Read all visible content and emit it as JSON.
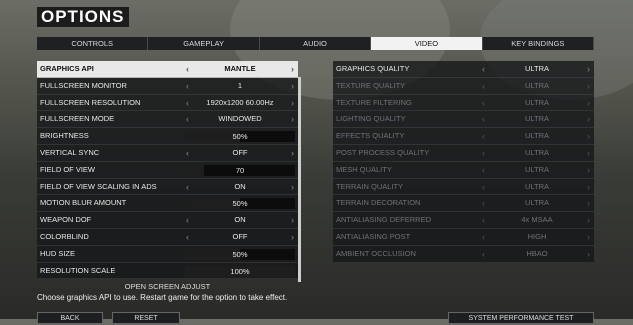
{
  "title": "OPTIONS",
  "tabs": [
    {
      "label": "CONTROLS",
      "active": false
    },
    {
      "label": "GAMEPLAY",
      "active": false
    },
    {
      "label": "AUDIO",
      "active": false
    },
    {
      "label": "VIDEO",
      "active": true
    },
    {
      "label": "KEY BINDINGS",
      "active": false
    }
  ],
  "left_settings": [
    {
      "label": "GRAPHICS API",
      "value": "MANTLE",
      "kind": "select",
      "selected": true
    },
    {
      "label": "FULLSCREEN MONITOR",
      "value": "1",
      "kind": "select"
    },
    {
      "label": "FULLSCREEN RESOLUTION",
      "value": "1920x1200 60.00Hz",
      "kind": "select"
    },
    {
      "label": "FULLSCREEN MODE",
      "value": "WINDOWED",
      "kind": "select"
    },
    {
      "label": "BRIGHTNESS",
      "value": "50%",
      "kind": "slider",
      "level": 0.5
    },
    {
      "label": "VERTICAL SYNC",
      "value": "OFF",
      "kind": "select"
    },
    {
      "label": "FIELD OF VIEW",
      "value": "70",
      "kind": "slider",
      "level": 0.17
    },
    {
      "label": "FIELD OF VIEW SCALING IN ADS",
      "value": "ON",
      "kind": "select"
    },
    {
      "label": "MOTION BLUR AMOUNT",
      "value": "50%",
      "kind": "slider",
      "level": 0.5
    },
    {
      "label": "WEAPON DOF",
      "value": "ON",
      "kind": "select"
    },
    {
      "label": "COLORBLIND",
      "value": "OFF",
      "kind": "select"
    },
    {
      "label": "HUD SIZE",
      "value": "50%",
      "kind": "slider",
      "level": 0.5
    },
    {
      "label": "RESOLUTION SCALE",
      "value": "100%",
      "kind": "slider",
      "level": 1.0
    }
  ],
  "right_settings": [
    {
      "label": "GRAPHICS QUALITY",
      "value": "ULTRA",
      "enabled": true
    },
    {
      "label": "TEXTURE QUALITY",
      "value": "ULTRA",
      "enabled": false
    },
    {
      "label": "TEXTURE FILTERING",
      "value": "ULTRA",
      "enabled": false
    },
    {
      "label": "LIGHTING QUALITY",
      "value": "ULTRA",
      "enabled": false
    },
    {
      "label": "EFFECTS QUALITY",
      "value": "ULTRA",
      "enabled": false
    },
    {
      "label": "POST PROCESS QUALITY",
      "value": "ULTRA",
      "enabled": false
    },
    {
      "label": "MESH QUALITY",
      "value": "ULTRA",
      "enabled": false
    },
    {
      "label": "TERRAIN QUALITY",
      "value": "ULTRA",
      "enabled": false
    },
    {
      "label": "TERRAIN DECORATION",
      "value": "ULTRA",
      "enabled": false
    },
    {
      "label": "ANTIALIASING DEFERRED",
      "value": "4x MSAA",
      "enabled": false
    },
    {
      "label": "ANTIALIASING POST",
      "value": "HIGH",
      "enabled": false
    },
    {
      "label": "AMBIENT OCCLUSION",
      "value": "HBAO",
      "enabled": false
    }
  ],
  "open_screen_adjust": "OPEN SCREEN ADJUST",
  "description": "Choose graphics API to use. Restart game for the option to take effect.",
  "buttons": {
    "back": "BACK",
    "reset": "RESET",
    "system_test": "SYSTEM PERFORMANCE TEST"
  },
  "icons": {
    "left_arrow": "chevron-left-icon",
    "right_arrow": "chevron-right-icon"
  },
  "colors": {
    "selected_row": "#e8e8e8",
    "active_tab": "#f2f2f2",
    "row_bg": "#141618"
  }
}
